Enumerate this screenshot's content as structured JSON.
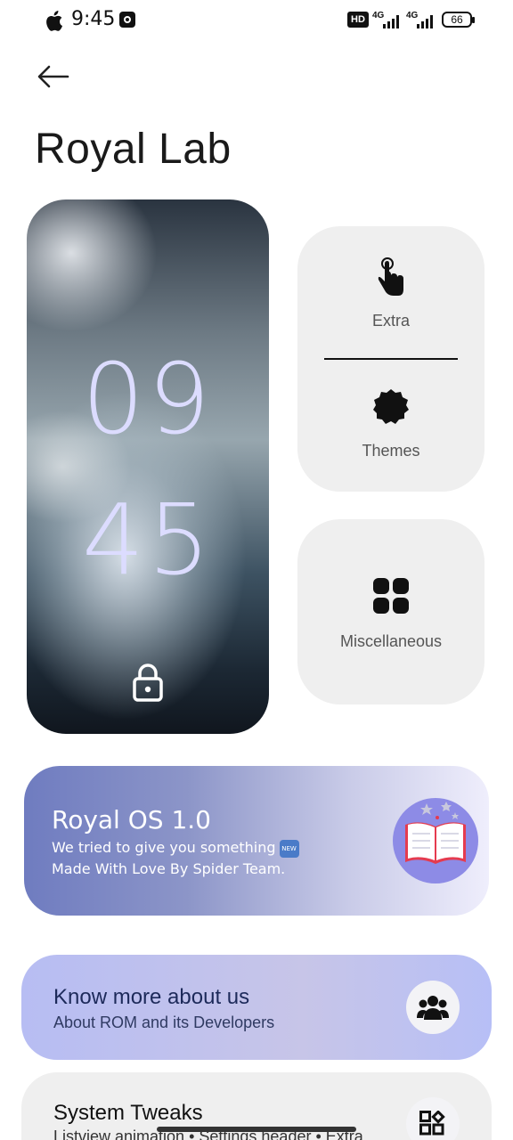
{
  "status_bar": {
    "time": "9:45",
    "hd_label": "HD",
    "signal_1_label": "4G",
    "signal_2_label": "4G",
    "battery": "66"
  },
  "header": {
    "back_icon": "arrow-left-icon",
    "title": "Royal Lab"
  },
  "clock": {
    "hour": "09",
    "minute": "45",
    "lock_icon": "lock-icon"
  },
  "tiles": {
    "extra": {
      "label": "Extra",
      "icon": "hand-pointer-icon"
    },
    "themes": {
      "label": "Themes",
      "icon": "badge-icon"
    },
    "misc": {
      "label": "Miscellaneous",
      "icon": "grid-four-icon"
    }
  },
  "banner": {
    "title": "Royal OS 1.0",
    "line1": "We tried to give you something",
    "new_badge": "NEW",
    "line2": "Made With Love By Spider Team.",
    "icon": "open-book-icon"
  },
  "cards": {
    "about": {
      "title": "Know more about us",
      "subtitle": "About ROM and its Developers",
      "icon": "people-icon"
    },
    "tweaks": {
      "title": "System Tweaks",
      "subtitle": "Listview animation  •  Settings header  •  Extra",
      "icon": "apps-icon"
    }
  },
  "colors": {
    "clock_digits": "#dcdcff",
    "banner_start": "#6f7cc0",
    "banner_end": "#efeefc",
    "card_about": "#b7bdf3",
    "tile_bg": "#efefef"
  }
}
